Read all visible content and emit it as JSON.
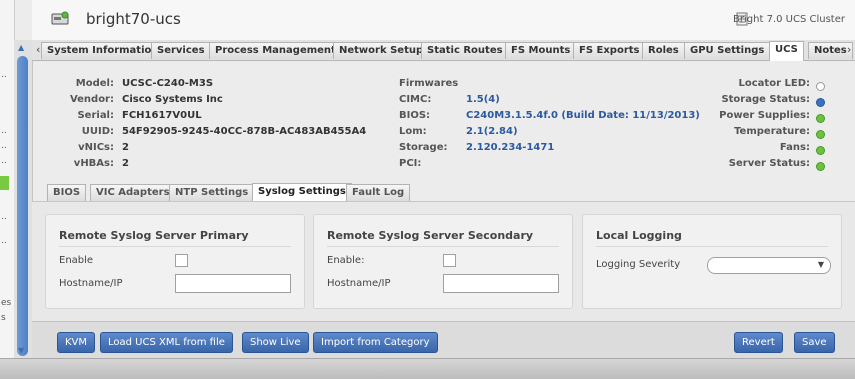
{
  "window": {
    "title": "bright70-ucs",
    "cluster_label": "Bright 7.0 UCS Cluster"
  },
  "left_strip": {
    "labels": [
      "..",
      "..",
      "..",
      "..",
      "..",
      "..",
      "es",
      "s"
    ]
  },
  "tabs": [
    {
      "label": "System Information",
      "active": false
    },
    {
      "label": "Services",
      "active": false
    },
    {
      "label": "Process Management",
      "active": false
    },
    {
      "label": "Network Setup",
      "active": false
    },
    {
      "label": "Static Routes",
      "active": false
    },
    {
      "label": "FS Mounts",
      "active": false
    },
    {
      "label": "FS Exports",
      "active": false
    },
    {
      "label": "Roles",
      "active": false
    },
    {
      "label": "GPU Settings",
      "active": false
    },
    {
      "label": "UCS",
      "active": true
    },
    {
      "label": "Notes",
      "active": false
    }
  ],
  "info": {
    "model": {
      "label": "Model:",
      "value": "UCSC-C240-M3S"
    },
    "vendor": {
      "label": "Vendor:",
      "value": "Cisco Systems Inc"
    },
    "serial": {
      "label": "Serial:",
      "value": "FCH1617V0UL"
    },
    "uuid": {
      "label": "UUID:",
      "value": "54F92905-9245-40CC-878B-AC483AB455A4"
    },
    "vnics": {
      "label": "vNICs:",
      "value": "2"
    },
    "vhbas": {
      "label": "vHBAs:",
      "value": "2"
    },
    "firmwares_heading": "Firmwares",
    "cimc": {
      "label": "CIMC:",
      "value": "1.5(4)"
    },
    "bios": {
      "label": "BIOS:",
      "value": "C240M3.1.5.4f.0 (Build Date: 11/13/2013)"
    },
    "lom": {
      "label": "Lom:",
      "value": "2.1(2.84)"
    },
    "storage": {
      "label": "Storage:",
      "value": "2.120.234-1471"
    },
    "pci": {
      "label": "PCI:",
      "value": ""
    }
  },
  "status": [
    {
      "label": "Locator LED:",
      "color": "#ffffff"
    },
    {
      "label": "Storage Status:",
      "color": "#3a73c6"
    },
    {
      "label": "Power Supplies:",
      "color": "#6ac43e"
    },
    {
      "label": "Temperature:",
      "color": "#6ac43e"
    },
    {
      "label": "Fans:",
      "color": "#6ac43e"
    },
    {
      "label": "Server Status:",
      "color": "#6ac43e"
    }
  ],
  "subtabs": [
    {
      "label": "BIOS",
      "active": false
    },
    {
      "label": "VIC Adapters",
      "active": false
    },
    {
      "label": "NTP Settings",
      "active": false
    },
    {
      "label": "Syslog Settings",
      "active": true
    },
    {
      "label": "Fault Log",
      "active": false
    }
  ],
  "syslog": {
    "primary": {
      "heading": "Remote Syslog Server Primary",
      "enable_label": "Enable",
      "host_label": "Hostname/IP",
      "host_value": ""
    },
    "secondary": {
      "heading": "Remote Syslog Server Secondary",
      "enable_label": "Enable:",
      "host_label": "Hostname/IP",
      "host_value": ""
    },
    "local": {
      "heading": "Local Logging",
      "severity_label": "Logging Severity",
      "severity_value": ""
    }
  },
  "toolbar": {
    "kvm": "KVM",
    "load_xml": "Load UCS XML from file",
    "show_live": "Show Live",
    "import": "Import from Category",
    "revert": "Revert",
    "save": "Save"
  }
}
